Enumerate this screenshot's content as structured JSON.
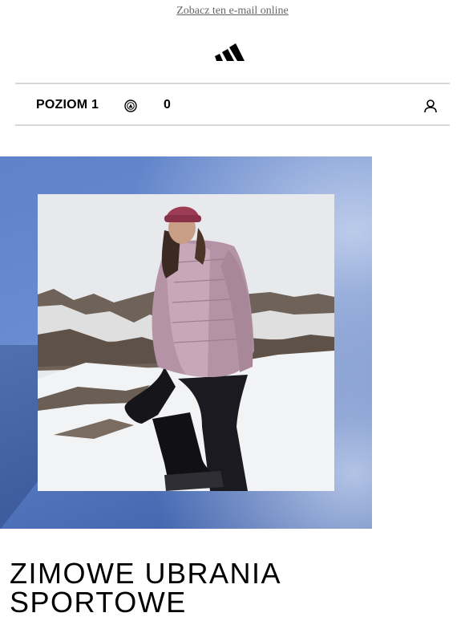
{
  "header": {
    "view_online_link": "Zobacz ten e-mail online",
    "logo_icon": "adidas-three-bars-logo-icon"
  },
  "membership_bar": {
    "level_label": "POZIOM 1",
    "points_icon": "adiclub-points-icon",
    "points_value": "0",
    "account_icon": "user-account-icon"
  },
  "hero": {
    "image_subject": "woman-hiking-snowy-mountain-photo"
  },
  "headline": {
    "line1": "ZIMOWE UBRANIA",
    "line2": "SPORTOWE"
  },
  "colors": {
    "hero_background": "#5f82c8",
    "divider": "#d7d7d7",
    "link_text": "#666666"
  }
}
